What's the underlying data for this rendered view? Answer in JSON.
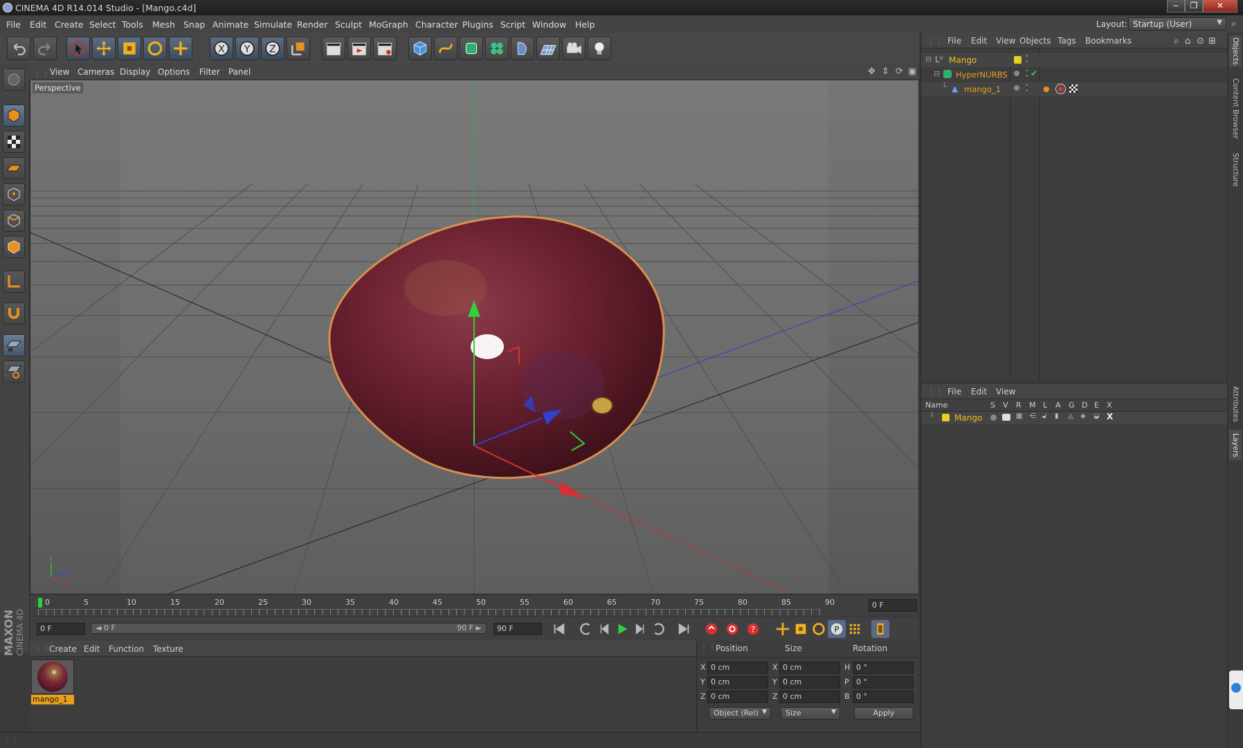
{
  "window": {
    "title": "CINEMA 4D R14.014 Studio - [Mango.c4d]",
    "minimize": "‒",
    "restore": "❐",
    "close": "✕"
  },
  "menu": [
    "File",
    "Edit",
    "Create",
    "Select",
    "Tools",
    "Mesh",
    "Snap",
    "Animate",
    "Simulate",
    "Render",
    "Sculpt",
    "MoGraph",
    "Character",
    "Plugins",
    "Script",
    "Window",
    "Help"
  ],
  "layout": {
    "label": "Layout:",
    "value": "Startup (User)"
  },
  "viewport": {
    "menu": [
      "View",
      "Cameras",
      "Display",
      "Options",
      "Filter",
      "Panel"
    ],
    "label": "Perspective"
  },
  "object_manager": {
    "menu": [
      "File",
      "Edit",
      "View",
      "Objects",
      "Tags",
      "Bookmarks"
    ],
    "objects": [
      {
        "name": "Mango",
        "color": "#e8c020"
      },
      {
        "name": "HyperNURBS",
        "color": "#e8a020"
      },
      {
        "name": "mango_1",
        "color": "#e8a020"
      }
    ]
  },
  "layer_manager": {
    "menu": [
      "File",
      "Edit",
      "View"
    ],
    "headers": [
      "Name",
      "S",
      "V",
      "R",
      "M",
      "L",
      "A",
      "G",
      "D",
      "E",
      "X"
    ],
    "layers": [
      {
        "name": "Mango",
        "color": "#e8c020"
      }
    ]
  },
  "side_tabs": [
    "Objects",
    "Content Browser",
    "Structure",
    "Attributes",
    "Layers"
  ],
  "timeline": {
    "ticks": [
      "0",
      "5",
      "10",
      "15",
      "20",
      "25",
      "30",
      "35",
      "40",
      "45",
      "50",
      "55",
      "60",
      "65",
      "70",
      "75",
      "80",
      "85",
      "90"
    ],
    "current_frame": "0 F",
    "start_field": "0 F",
    "range_start": "◄ 0 F",
    "range_end": "90 F ►",
    "end_field": "90 F"
  },
  "material_manager": {
    "menu": [
      "Create",
      "Edit",
      "Function",
      "Texture"
    ],
    "materials": [
      {
        "name": "mango_1"
      }
    ]
  },
  "coordinates": {
    "headers": [
      "Position",
      "Size",
      "Rotation"
    ],
    "rows": [
      {
        "axis": "X",
        "pos": "0 cm",
        "size_axis": "X",
        "size": "0 cm",
        "rot_axis": "H",
        "rot": "0 °"
      },
      {
        "axis": "Y",
        "pos": "0 cm",
        "size_axis": "Y",
        "size": "0 cm",
        "rot_axis": "P",
        "rot": "0 °"
      },
      {
        "axis": "Z",
        "pos": "0 cm",
        "size_axis": "Z",
        "size": "0 cm",
        "rot_axis": "B",
        "rot": "0 °"
      }
    ],
    "mode": "Object (Rel)",
    "size_mode": "Size",
    "apply": "Apply"
  },
  "brand": {
    "line1": "MAXON",
    "line2": "CINEMA 4D"
  }
}
